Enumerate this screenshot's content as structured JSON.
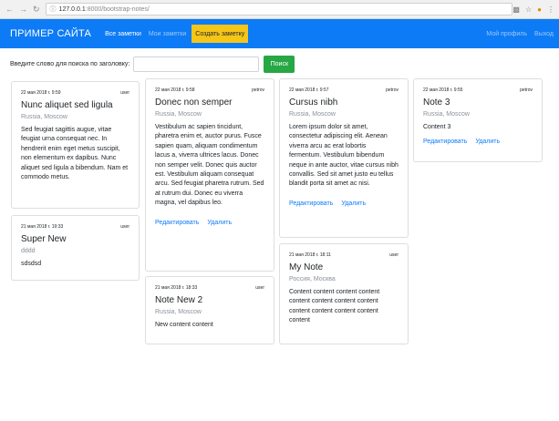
{
  "browser": {
    "url_host": "127.0.0.1",
    "url_path": ":8000/bootstrap-notes/"
  },
  "navbar": {
    "brand": "ПРИМЕР САЙТА",
    "all_notes": "Все заметки",
    "my_notes": "Мои заметки",
    "create_note": "Создать заметку",
    "profile": "Мой профиль",
    "logout": "Выход"
  },
  "search": {
    "label": "Введите слово для поиска по заголовку:",
    "value": "",
    "placeholder": "",
    "button": "Поиск"
  },
  "notes": [
    {
      "date": "22 мая 2018 г. 9:59",
      "user": "user",
      "title": "Nunc aliquet sed ligula",
      "location": "Russia, Moscow",
      "text": "Sed feugiat sagittis augue, vitae feugiat urna consequat nec. In hendrerit enim eget metus suscipit, non elementum ex dapibus. Nunc aliquet sed ligula a bibendum. Nam et commodo metus."
    },
    {
      "date": "21 мая 2018 г. 19:33",
      "user": "user",
      "title": "Super New",
      "location": "dddd",
      "text": "sdsdsd"
    },
    {
      "date": "22 мая 2018 г. 9:58",
      "user": "petrov",
      "title": "Donec non semper",
      "location": "Russia, Moscow",
      "text": "Vestibulum ac sapien tincidunt, pharetra enim et, auctor purus. Fusce sapien quam, aliquam condimentum lacus a, viverra ultrices lacus. Donec non semper velit. Donec quis auctor est. Vestibulum aliquam consequat arcu. Sed feugiat pharetra rutrum. Sed at rutrum dui. Donec eu viverra magna, vel dapibus leo.",
      "edit": "Редактировать",
      "delete": "Удалить"
    },
    {
      "date": "21 мая 2018 г. 18:33",
      "user": "user",
      "title": "Note New 2",
      "location": "Russia, Moscow",
      "text": "New content content"
    },
    {
      "date": "22 мая 2018 г. 9:57",
      "user": "petrov",
      "title": "Cursus nibh",
      "location": "Russia, Moscow",
      "text": "Lorem ipsum dolor sit amet, consectetur adipiscing elit. Aenean viverra arcu ac erat lobortis fermentum. Vestibulum bibendum neque in ante auctor, vitae cursus nibh convallis. Sed sit amet justo eu tellus blandit porta sit amet ac nisi.",
      "edit": "Редактировать",
      "delete": "Удалить"
    },
    {
      "date": "21 мая 2018 г. 18:11",
      "user": "user",
      "title": "My Note",
      "location": "Россия, Москва",
      "text": "Content content content content content content content content content content content content content"
    },
    {
      "date": "22 мая 2018 г. 9:55",
      "user": "petrov",
      "title": "Note 3",
      "location": "Russia, Moscow",
      "text": "Content 3",
      "edit": "Редактировать",
      "delete": "Удалить"
    }
  ]
}
